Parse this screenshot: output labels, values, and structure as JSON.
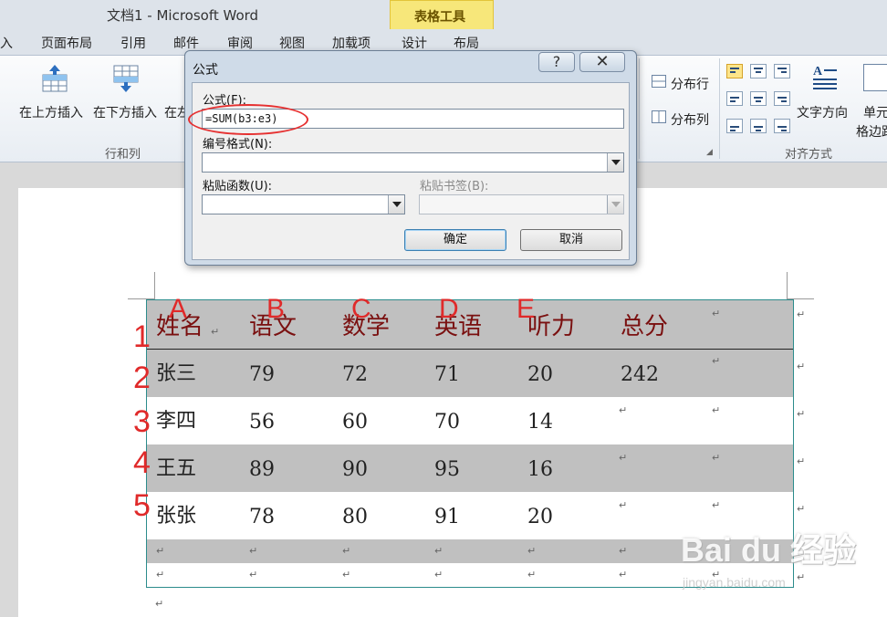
{
  "window": {
    "title": "文档1 - Microsoft Word"
  },
  "ribbon_tabs": [
    {
      "label": "入"
    },
    {
      "label": "页面布局"
    },
    {
      "label": "引用"
    },
    {
      "label": "邮件"
    },
    {
      "label": "审阅"
    },
    {
      "label": "视图"
    },
    {
      "label": "加载项"
    },
    {
      "label": "设计"
    },
    {
      "label": "布局"
    }
  ],
  "contextual_tab_header": "表格工具",
  "ribbon": {
    "insert_above": "在上方插入",
    "insert_below": "在下方插入",
    "insert_left_partial": "在左",
    "rows_cols_group": "行和列",
    "distribute_rows": "分布行",
    "distribute_cols": "分布列",
    "text_direction": "文字方向",
    "cell_margins_line1": "单元",
    "cell_margins_line2": "格边距",
    "align_group": "对齐方式"
  },
  "dialog": {
    "title": "公式",
    "help": "?",
    "close": "✕",
    "formula_label": "公式(F):",
    "formula_value": "=SUM(b3:e3)",
    "number_format_label": "编号格式(N):",
    "number_format_value": "",
    "paste_function_label": "粘贴函数(U):",
    "paste_bookmark_label": "粘贴书签(B):",
    "ok": "确定",
    "cancel": "取消"
  },
  "annotations": {
    "columns": [
      "A",
      "B",
      "C",
      "D",
      "E"
    ],
    "rows": [
      "1",
      "2",
      "3",
      "4",
      "5"
    ]
  },
  "table": {
    "headers": [
      "姓名",
      "语文",
      "数学",
      "英语",
      "听力",
      "总分",
      ""
    ],
    "rows": [
      [
        "张三",
        "79",
        "72",
        "71",
        "20",
        "242",
        ""
      ],
      [
        "李四",
        "56",
        "60",
        "70",
        "14",
        "",
        ""
      ],
      [
        "王五",
        "89",
        "90",
        "95",
        "16",
        "",
        ""
      ],
      [
        "张张",
        "78",
        "80",
        "91",
        "20",
        "",
        ""
      ],
      [
        "",
        "",
        "",
        "",
        "",
        "",
        ""
      ],
      [
        "",
        "",
        "",
        "",
        "",
        "",
        ""
      ]
    ]
  },
  "marks": {
    "pilcrow": "↵"
  },
  "watermark": {
    "main": "Bai du 经验",
    "sub": "jingyan.baidu.com"
  },
  "colors": {
    "accent_red": "#e02a2a",
    "header_text": "#7a1010",
    "table_border": "#2c8c8c",
    "shade": "#c0c0c0"
  }
}
